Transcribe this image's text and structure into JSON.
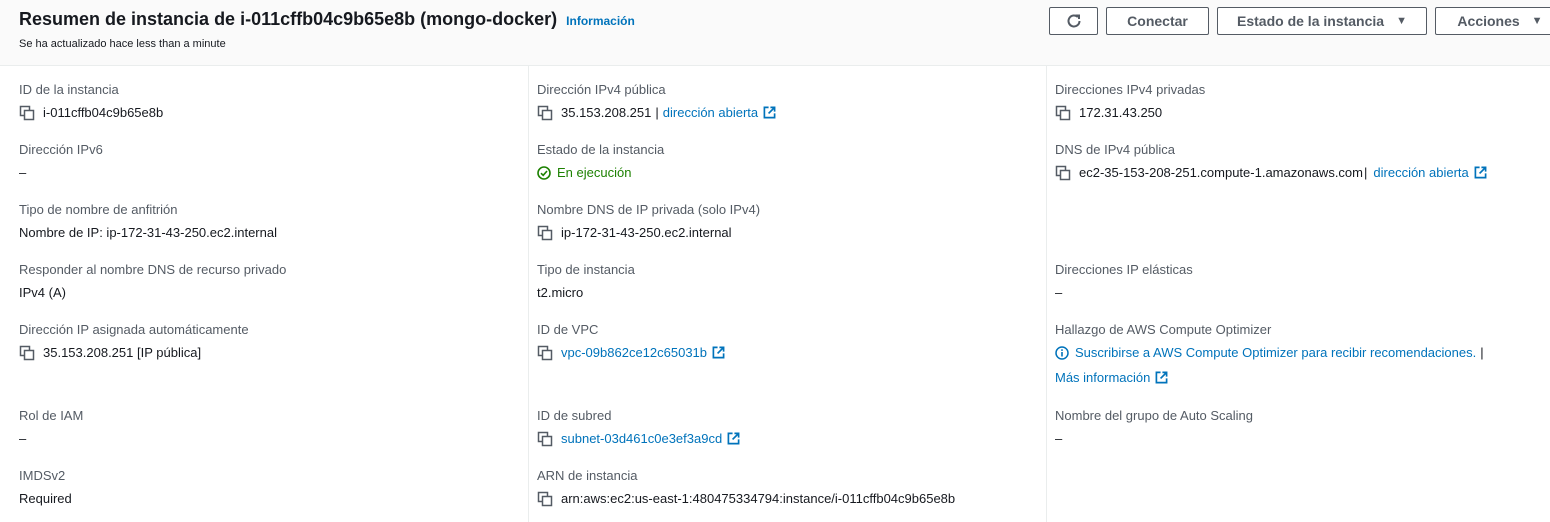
{
  "header": {
    "title": "Resumen de instancia de i-011cffb04c9b65e8b (mongo-docker)",
    "info_link": "Información",
    "updated": "Se ha actualizado hace less than a minute",
    "buttons": {
      "connect": "Conectar",
      "instance_state": "Estado de la instancia",
      "actions": "Acciones"
    }
  },
  "col1": {
    "instance_id": {
      "label": "ID de la instancia",
      "value": "i-011cffb04c9b65e8b"
    },
    "ipv6": {
      "label": "Dirección IPv6",
      "value": "–"
    },
    "hostname_type": {
      "label": "Tipo de nombre de anfitrión",
      "value": "Nombre de IP: ip-172-31-43-250.ec2.internal"
    },
    "private_dns_answer": {
      "label": "Responder al nombre DNS de recurso privado",
      "value": "IPv4 (A)"
    },
    "auto_ip": {
      "label": "Dirección IP asignada automáticamente",
      "value": "35.153.208.251 [IP pública]"
    },
    "iam_role": {
      "label": "Rol de IAM",
      "value": "–"
    },
    "imdsv2": {
      "label": "IMDSv2",
      "value": "Required"
    }
  },
  "col2": {
    "public_ipv4": {
      "label": "Dirección IPv4 pública",
      "value": "35.153.208.251",
      "sep": "|",
      "link": "dirección abierta"
    },
    "instance_state": {
      "label": "Estado de la instancia",
      "value": "En ejecución"
    },
    "private_dns": {
      "label": "Nombre DNS de IP privada (solo IPv4)",
      "value": "ip-172-31-43-250.ec2.internal"
    },
    "instance_type": {
      "label": "Tipo de instancia",
      "value": "t2.micro"
    },
    "vpc_id": {
      "label": "ID de VPC",
      "value": "vpc-09b862ce12c65031b"
    },
    "subnet_id": {
      "label": "ID de subred",
      "value": "subnet-03d461c0e3ef3a9cd"
    },
    "arn": {
      "label": "ARN de instancia",
      "value": "arn:aws:ec2:us-east-1:480475334794:instance/i-011cffb04c9b65e8b"
    }
  },
  "col3": {
    "private_ipv4": {
      "label": "Direcciones IPv4 privadas",
      "value": "172.31.43.250"
    },
    "public_dns": {
      "label": "DNS de IPv4 pública",
      "value": "ec2-35-153-208-251.compute-1.amazonaws.com",
      "sep": "|",
      "link": "dirección abierta"
    },
    "elastic_ip": {
      "label": "Direcciones IP elásticas",
      "value": "–"
    },
    "optimizer": {
      "label": "Hallazgo de AWS Compute Optimizer",
      "value": "Suscribirse a AWS Compute Optimizer para recibir recomendaciones.",
      "sep": "|",
      "link": "Más información"
    },
    "asg": {
      "label": "Nombre del grupo de Auto Scaling",
      "value": "–"
    }
  },
  "colors": {
    "link": "#0073bb",
    "running": "#1d8102",
    "label": "#545b64"
  }
}
